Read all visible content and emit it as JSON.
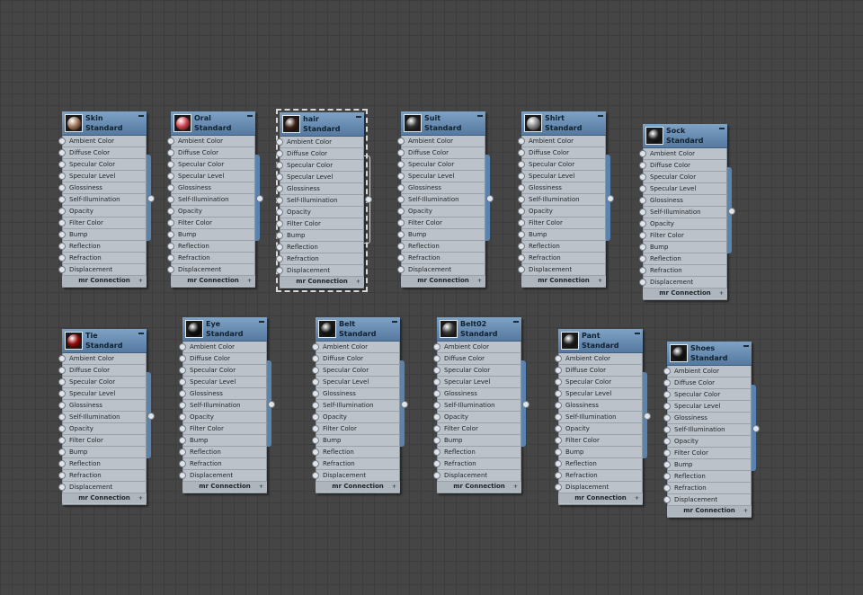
{
  "slots": [
    "Ambient Color",
    "Diffuse Color",
    "Specular Color",
    "Specular Level",
    "Glossiness",
    "Self-Illumination",
    "Opacity",
    "Filter Color",
    "Bump",
    "Reflection",
    "Refraction",
    "Displacement"
  ],
  "footer_label": "mr Connection",
  "footer_arrow": "+",
  "nodes": [
    {
      "name": "Skin",
      "type": "Standard",
      "color": "#a0765a",
      "selected": false
    },
    {
      "name": "Oral",
      "type": "Standard",
      "color": "#d44450",
      "selected": false
    },
    {
      "name": "hair",
      "type": "Standard",
      "color": "#3d2218",
      "selected": true
    },
    {
      "name": "Suit",
      "type": "Standard",
      "color": "#333333",
      "selected": false
    },
    {
      "name": "Shirt",
      "type": "Standard",
      "color": "#8a8a8a",
      "selected": false
    },
    {
      "name": "Sock",
      "type": "Standard",
      "color": "#1b1b1b",
      "selected": false
    },
    {
      "name": "Tie",
      "type": "Standard",
      "color": "#9a0a0a",
      "selected": false
    },
    {
      "name": "Eye",
      "type": "Standard",
      "color": "#101010",
      "selected": false
    },
    {
      "name": "Belt",
      "type": "Standard",
      "color": "#181818",
      "selected": false
    },
    {
      "name": "Belt02",
      "type": "Standard",
      "color": "#3a3a3a",
      "selected": false
    },
    {
      "name": "Pant",
      "type": "Standard",
      "color": "#202020",
      "selected": false
    },
    {
      "name": "Shoes",
      "type": "Standard",
      "color": "#151515",
      "selected": false
    }
  ]
}
